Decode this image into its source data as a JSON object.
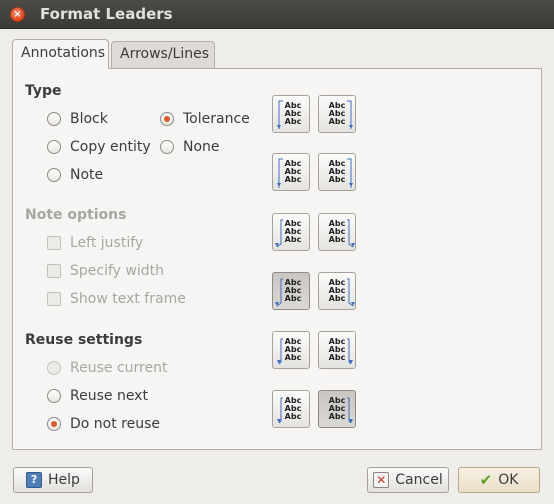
{
  "window": {
    "title": "Format Leaders"
  },
  "tabs": [
    {
      "label": "Annotations",
      "active": true
    },
    {
      "label": "Arrows/Lines",
      "active": false
    }
  ],
  "type_section": {
    "heading": "Type",
    "options": [
      {
        "label": "Block",
        "checked": false
      },
      {
        "label": "Copy entity",
        "checked": false
      },
      {
        "label": "Note",
        "checked": false
      },
      {
        "label": "Tolerance",
        "checked": true
      },
      {
        "label": "None",
        "checked": false
      }
    ]
  },
  "note_options": {
    "heading": "Note options",
    "enabled": false,
    "items": [
      {
        "label": "Left justify",
        "checked": false
      },
      {
        "label": "Specify width",
        "checked": false
      },
      {
        "label": "Show text frame",
        "checked": false
      }
    ]
  },
  "reuse_settings": {
    "heading": "Reuse settings",
    "options": [
      {
        "label": "Reuse current",
        "checked": false,
        "enabled": false
      },
      {
        "label": "Reuse next",
        "checked": false,
        "enabled": true
      },
      {
        "label": "Do not reuse",
        "checked": true,
        "enabled": true
      }
    ]
  },
  "leader_styles": {
    "sample_text": "Abc",
    "icons": [
      "leader-style-icon"
    ],
    "pressed": [
      6,
      11
    ]
  },
  "footer": {
    "help_label": "Help",
    "cancel_label": "Cancel",
    "ok_label": "OK"
  },
  "colors": {
    "accent": "#e05a2b",
    "leader_line": "#3b6fc2",
    "titlebar": "#3e3d39"
  }
}
